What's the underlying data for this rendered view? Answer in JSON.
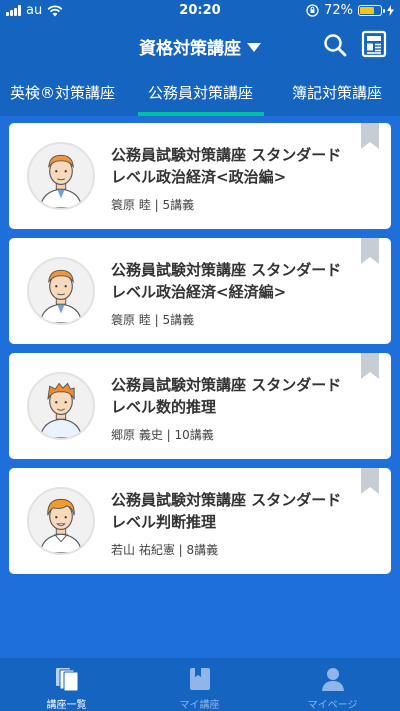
{
  "status_bar": {
    "carrier": "au",
    "time": "20:20",
    "battery": "72%",
    "battery_level": 0.72
  },
  "header": {
    "title": "資格対策講座",
    "icons": [
      "search-icon",
      "newspaper-icon",
      "chevron-down-icon"
    ]
  },
  "tabs": [
    {
      "label": "英検®対策講座"
    },
    {
      "label": "公務員対策講座"
    },
    {
      "label": "簿記対策講座"
    }
  ],
  "active_tab": 1,
  "courses": [
    {
      "title": "公務員試験対策講座 スタンダード レベル政治経済<政治編>",
      "meta": "簑原 睦 | 5講義"
    },
    {
      "title": "公務員試験対策講座 スタンダード レベル政治経済<経済編>",
      "meta": "簑原 睦 | 5講義"
    },
    {
      "title": "公務員試験対策講座 スタンダード レベル数的推理",
      "meta": "郷原 義史 | 10講義"
    },
    {
      "title": "公務員試験対策講座 スタンダード レベル判断推理",
      "meta": "若山 祐紀憲 | 8講義"
    }
  ],
  "bottom_nav": [
    {
      "label": "講座一覧",
      "icon": "library-icon"
    },
    {
      "label": "マイ講座",
      "icon": "book-icon"
    },
    {
      "label": "マイページ",
      "icon": "person-icon"
    }
  ],
  "colors": {
    "header": "#1565C0",
    "background": "#1E6FD9",
    "tab_indicator": "#00BFA5",
    "bookmark": "#C7CDD4"
  }
}
